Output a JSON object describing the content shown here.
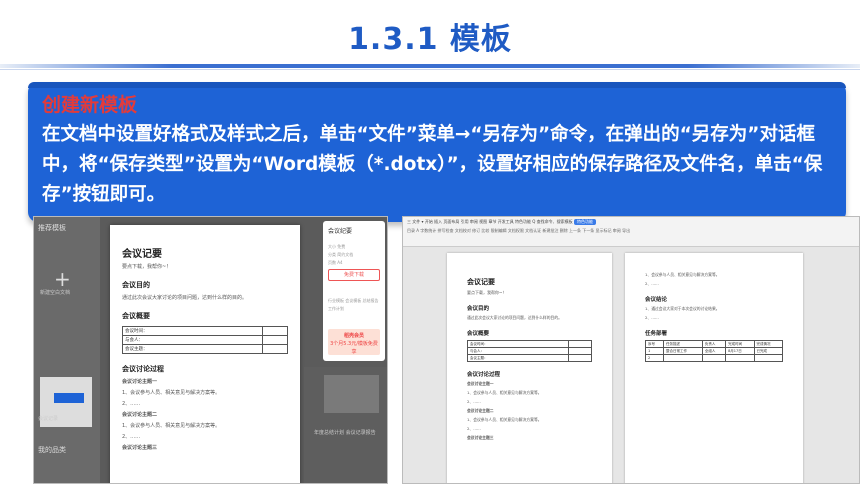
{
  "slide": {
    "title": "1.3.1  模板",
    "subtitle": "创建新模板",
    "paragraph": "在文档中设置好格式及样式之后，单击“文件”菜单→“另存为”命令，在弹出的“另存为”对话框中，将“保存类型”设置为“Word模板（*.dotx）”，设置好相应的保存路径及文件名，单击“保存”按钮即可。"
  },
  "left_shot": {
    "panel_title": "推荐模板",
    "new_label": "新建空白文档",
    "card_caption": "会议记录",
    "tab_label": "我的品类",
    "doc": {
      "title": "会议记要",
      "subtitle": "要点下载，我帮你~！",
      "purpose_heading": "会议目的",
      "purpose_text": "通过此次会议大家讨论的项目问题，达到什么样的目的。",
      "summary_heading": "会议概要",
      "rows": [
        "会议时间：",
        "与会人：",
        "会议主题："
      ],
      "discussion_heading": "会议讨论过程",
      "topic1": "会议讨论主题一",
      "item1": "1、会议参与人员、相关意见与解决方案等。",
      "item1b": "2、……",
      "topic2": "会议讨论主题二",
      "item2": "1、会议参与人员、相关意见与解决方案等。",
      "item2b": "2、……",
      "topic3": "会议讨论主题三"
    },
    "side": {
      "title": "会议纪要",
      "meta1": "大小    免费",
      "meta2": "分类    简约文档",
      "meta3": "页数    A4",
      "download_btn": "免费下载",
      "tags": "行业模板  会议模板  总结报告  工作计划",
      "vip": "稻壳会员",
      "vip_promo": "3个月5.3元/模板免费享"
    },
    "right_caption": "年度总结计划 会议记录报告"
  },
  "right_shot": {
    "menu": "三 文件 ▾  开始  插入  页面布局  引用  审阅  视图  章节  开发工具  特色功能  Q 查找命令、搜索模板",
    "menu_active": "特色功能",
    "toolbar": "目录  A 字数统计  拼写检查  文档校对  修订  比较  限制编辑  文档权限  文档认证  新建批注  删除  上一条  下一条  显示标记  审阅  导出",
    "pageA": {
      "title": "会议记要",
      "subtitle": "要点下载，我帮你~！",
      "purpose_heading": "会议目的",
      "purpose_text": "通过此次会议大家讨论的项目问题，达到什么样的目的。",
      "summary_heading": "会议概要",
      "rows": [
        "会议时间：",
        "与会人：",
        "会议主题："
      ],
      "discussion_heading": "会议讨论过程",
      "topic1": "会议讨论主题一",
      "item1": "1、会议参与人员、相关意见与解决方案等。",
      "item1b": "2、……",
      "topic2": "会议讨论主题二",
      "item2": "1、会议参与人员、相关意见与解决方案等。",
      "item2b": "2、……",
      "topic3": "会议讨论主题三"
    },
    "pageB": {
      "item1": "1、会议参与人员、相关意见与解决方案等。",
      "item1b": "2、……",
      "conclusion_heading": "会议结论",
      "conclusion_item": "1、通过会议大家对于本次会议的讨论结果。",
      "conclusion_item2": "2、……",
      "task_heading": "任务部署",
      "table_headers": [
        "序号",
        "任务描述",
        "负责人",
        "完成时间",
        "完成情况"
      ],
      "table_row1": [
        "1",
        "整合日常工作",
        "全组人",
        "8月17日",
        "已完成"
      ],
      "table_row2": [
        "2",
        "",
        "",
        "",
        ""
      ]
    }
  }
}
